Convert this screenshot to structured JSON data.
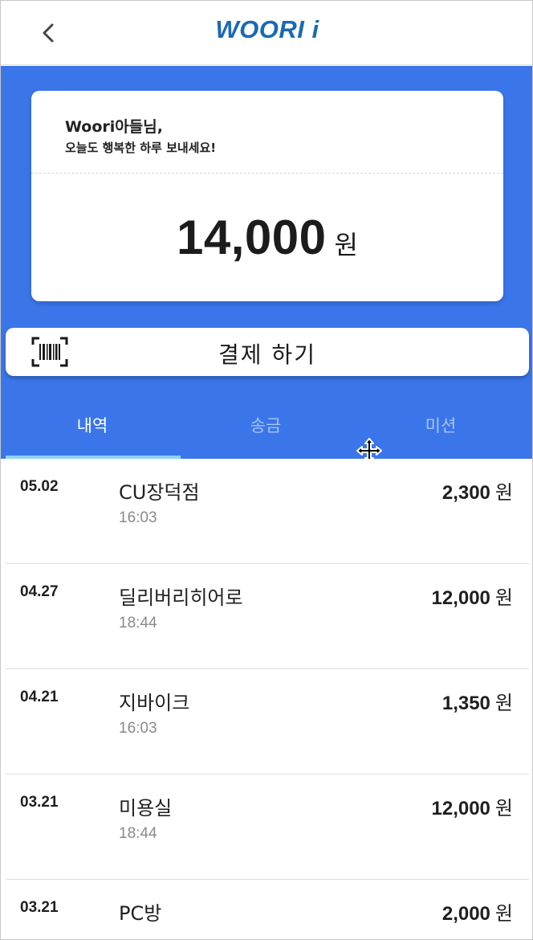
{
  "header": {
    "logo_text": "WOORI i",
    "back_icon": "chevron-left-icon"
  },
  "card": {
    "greeting_name": "Woori아들님,",
    "greeting_message": "오늘도 행복한 하루 보내세요!",
    "balance_amount": "14,000",
    "balance_unit": "원"
  },
  "pay_button": {
    "label": "결제 하기",
    "icon": "barcode-scan-icon"
  },
  "tabs": [
    {
      "label": "내역",
      "active": true
    },
    {
      "label": "송금",
      "active": false
    },
    {
      "label": "미션",
      "active": false
    }
  ],
  "transactions": [
    {
      "date": "05.02",
      "merchant": "CU장덕점",
      "time": "16:03",
      "amount": "2,300",
      "unit": "원"
    },
    {
      "date": "04.27",
      "merchant": "딜리버리히어로",
      "time": "18:44",
      "amount": "12,000",
      "unit": "원"
    },
    {
      "date": "04.21",
      "merchant": "지바이크",
      "time": "16:03",
      "amount": "1,350",
      "unit": "원"
    },
    {
      "date": "03.21",
      "merchant": "미용실",
      "time": "18:44",
      "amount": "12,000",
      "unit": "원"
    },
    {
      "date": "03.21",
      "merchant": "PC방",
      "time": "",
      "amount": "2,000",
      "unit": "원"
    }
  ],
  "colors": {
    "primary_blue": "#3a76ea",
    "logo_blue": "#1b6ab0",
    "tab_indicator": "#8fd2f3"
  }
}
